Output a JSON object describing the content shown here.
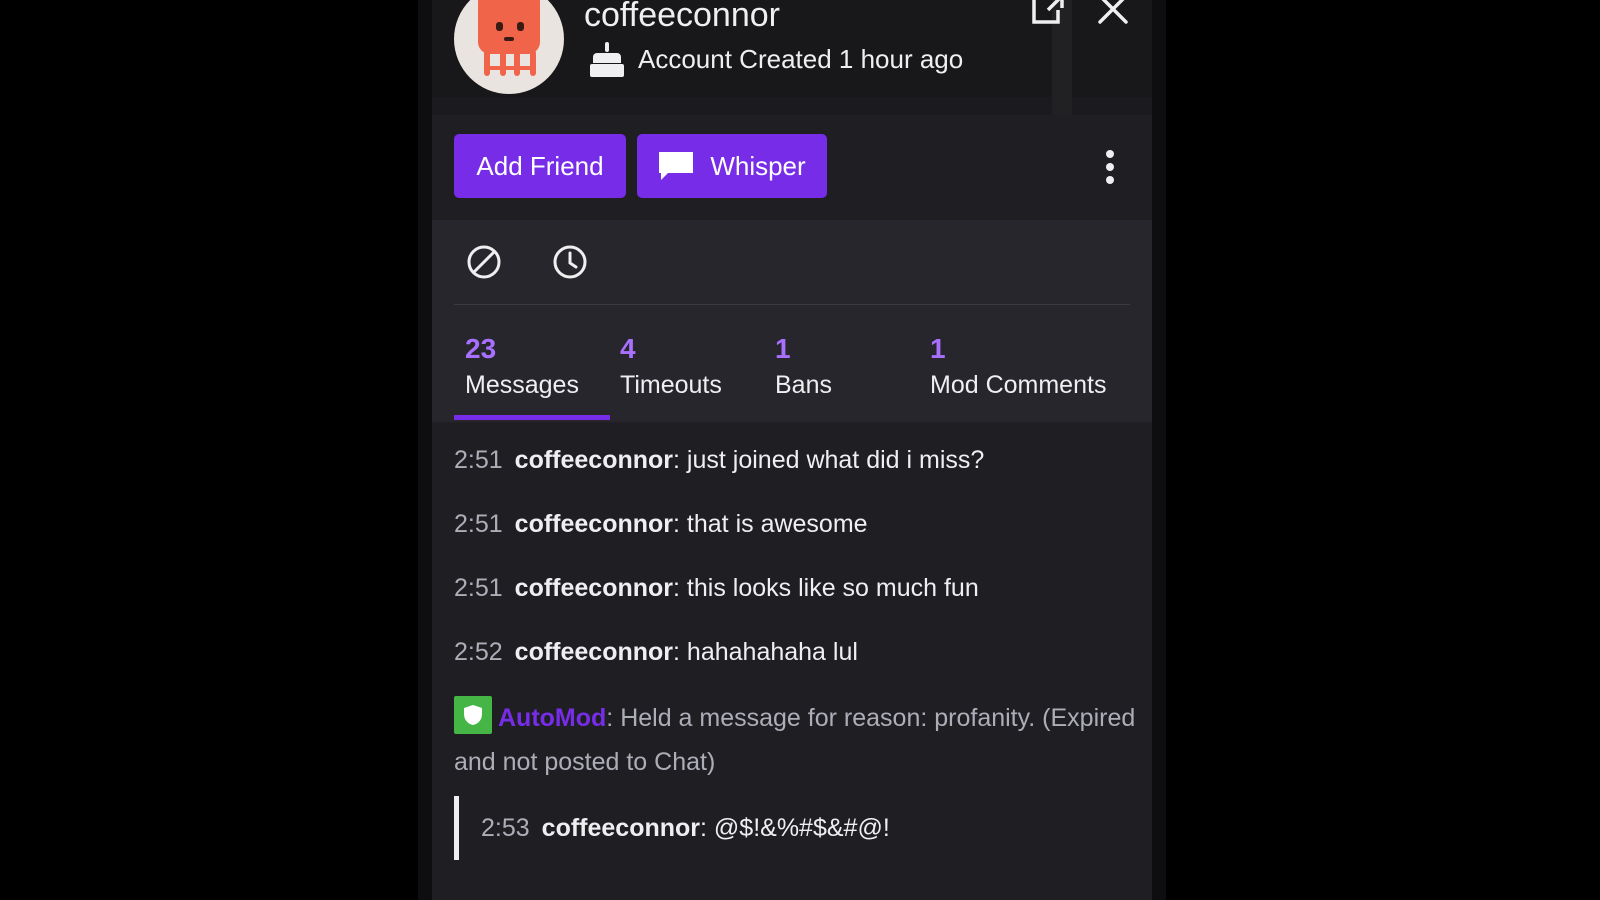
{
  "profile": {
    "username": "coffeeconnor",
    "account_created": "Account Created 1 hour ago"
  },
  "actions": {
    "add_friend_label": "Add Friend",
    "whisper_label": "Whisper"
  },
  "stats": [
    {
      "count": "23",
      "label": "Messages"
    },
    {
      "count": "4",
      "label": "Timeouts"
    },
    {
      "count": "1",
      "label": "Bans"
    },
    {
      "count": "1",
      "label": "Mod Comments"
    }
  ],
  "messages": [
    {
      "time": "2:51",
      "user": "coffeeconnor",
      "text": ": just joined what did i miss?"
    },
    {
      "time": "2:51",
      "user": "coffeeconnor",
      "text": ": that is awesome"
    },
    {
      "time": "2:51",
      "user": "coffeeconnor",
      "text": ": this looks like so much fun"
    },
    {
      "time": "2:52",
      "user": "coffeeconnor",
      "text": ": hahahahaha lul"
    }
  ],
  "automod": {
    "name": "AutoMod",
    "text": ": Held a message for reason: profanity. (Expired and not posted to Chat)",
    "held": {
      "time": "2:53",
      "user": "coffeeconnor",
      "text": ": @$!&%#$&#@!"
    }
  },
  "colors": {
    "accent": "#772ce8",
    "accent_text": "#a970ff",
    "automod_badge": "#45b645"
  }
}
